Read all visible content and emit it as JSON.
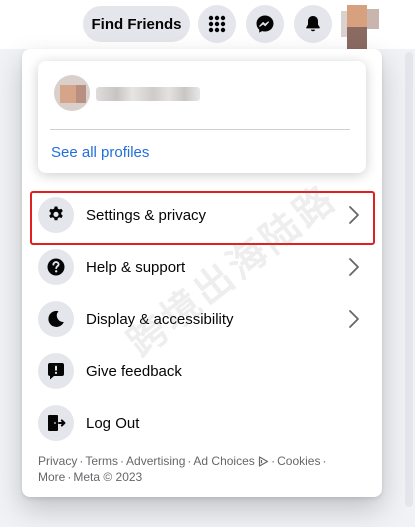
{
  "topbar": {
    "find_friends_label": "Find Friends",
    "menu_icon": "grid-icon",
    "messenger_icon": "messenger-icon",
    "notifications_icon": "bell-icon"
  },
  "dropdown": {
    "profile_card": {
      "see_all_label": "See all profiles"
    },
    "items": [
      {
        "label": "Settings & privacy",
        "icon": "gear-icon",
        "has_chevron": true
      },
      {
        "label": "Help & support",
        "icon": "question-icon",
        "has_chevron": true
      },
      {
        "label": "Display & accessibility",
        "icon": "moon-icon",
        "has_chevron": true
      },
      {
        "label": "Give feedback",
        "icon": "feedback-icon",
        "has_chevron": false
      },
      {
        "label": "Log Out",
        "icon": "logout-icon",
        "has_chevron": false
      }
    ],
    "footer": {
      "links": [
        "Privacy",
        "Terms",
        "Advertising",
        "Ad Choices",
        "Cookies",
        "More"
      ],
      "separator": "·",
      "copyright": "Meta © 2023"
    }
  },
  "watermark_text": "跨境出海陆路",
  "colors": {
    "link_blue": "#216fdb",
    "highlight_red": "#e02020",
    "icon_bg": "#e4e6eb"
  }
}
